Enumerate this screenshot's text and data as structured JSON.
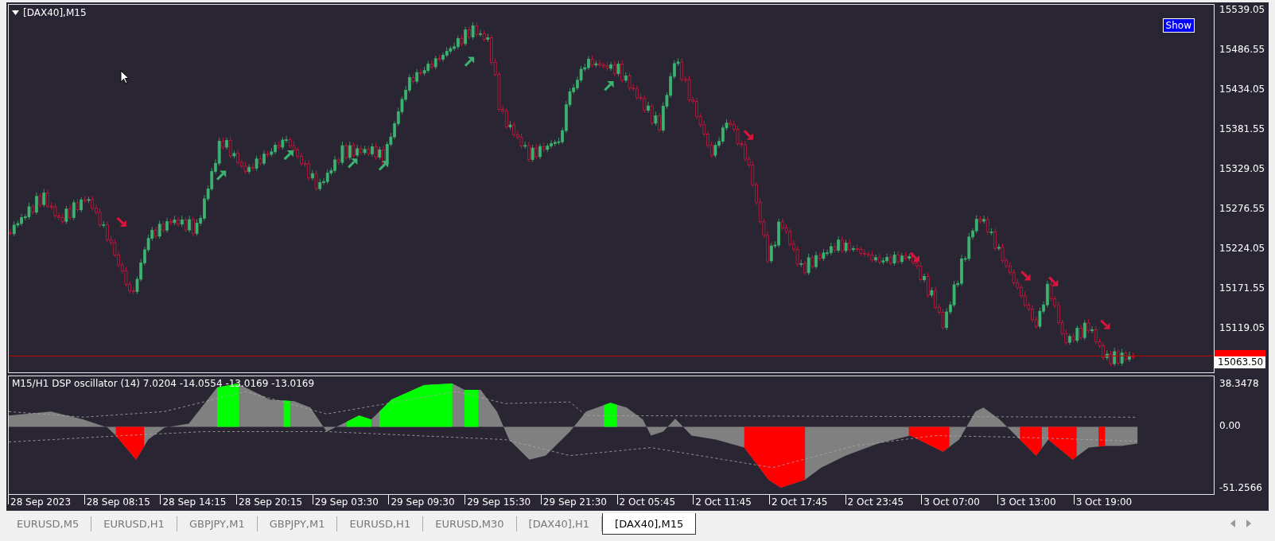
{
  "chart": {
    "title": "[DAX40],M15",
    "show_button": "Show"
  },
  "price_axis": {
    "ticks": [
      "15539.05",
      "15486.55",
      "15434.05",
      "15381.55",
      "15329.05",
      "15276.55",
      "15224.05",
      "15171.55",
      "15119.05"
    ],
    "current_price": "15063.50"
  },
  "oscillator": {
    "label": "M15/H1 DSP oscillator (14) 7.0204 -14.0554 -13.0169 -13.0169",
    "ticks": [
      "38.3478",
      "0.00",
      "-51.2566"
    ]
  },
  "time_axis": [
    "28 Sep 2023",
    "28 Sep 08:15",
    "28 Sep 14:15",
    "28 Sep 20:15",
    "29 Sep 03:30",
    "29 Sep 09:30",
    "29 Sep 15:30",
    "29 Sep 21:30",
    "2 Oct 05:45",
    "2 Oct 11:45",
    "2 Oct 17:45",
    "2 Oct 23:45",
    "3 Oct 07:00",
    "3 Oct 13:00",
    "3 Oct 19:00"
  ],
  "tabs": [
    {
      "label": "EURUSD,M5",
      "selected": false
    },
    {
      "label": "EURUSD,H1",
      "selected": false
    },
    {
      "label": "GBPJPY,M1",
      "selected": false
    },
    {
      "label": "GBPJPY,M1",
      "selected": false
    },
    {
      "label": "EURUSD,H1",
      "selected": false
    },
    {
      "label": "EURUSD,M30",
      "selected": false
    },
    {
      "label": "[DAX40],H1",
      "selected": false
    },
    {
      "label": "[DAX40],M15",
      "selected": true
    }
  ]
}
